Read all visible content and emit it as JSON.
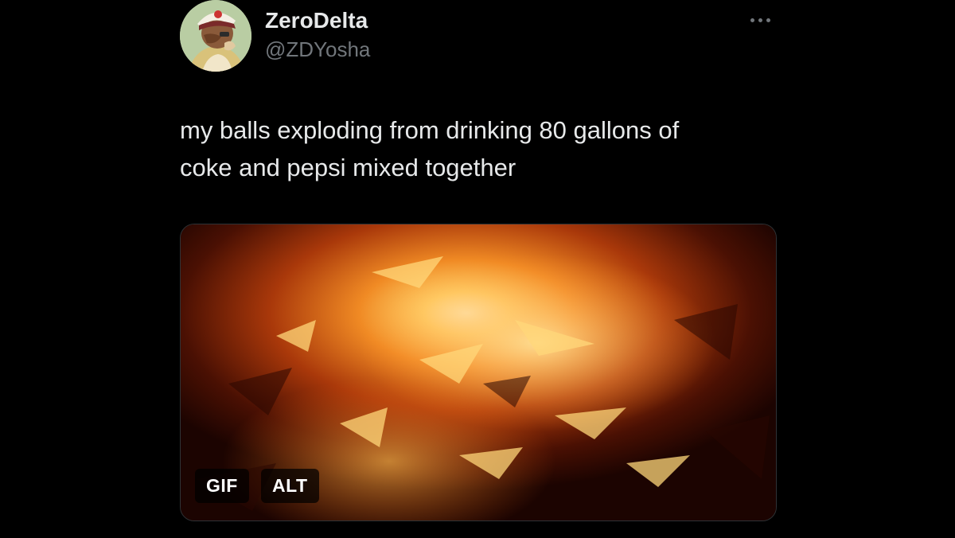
{
  "tweet": {
    "author": {
      "display_name": "ZeroDelta",
      "handle": "@ZDYosha",
      "avatar_icon": "cartoon-character-avatar"
    },
    "more_icon": "more-dots-icon",
    "text": "my balls exploding from drinking 80 gallons of\ncoke and pepsi mixed together",
    "media": {
      "type": "gif",
      "gif_badge": "GIF",
      "alt_badge": "ALT"
    }
  },
  "colors": {
    "background": "#000000",
    "primary_text": "#e7e9ea",
    "secondary_text": "#71767b",
    "media_glow": "#ffb347"
  }
}
